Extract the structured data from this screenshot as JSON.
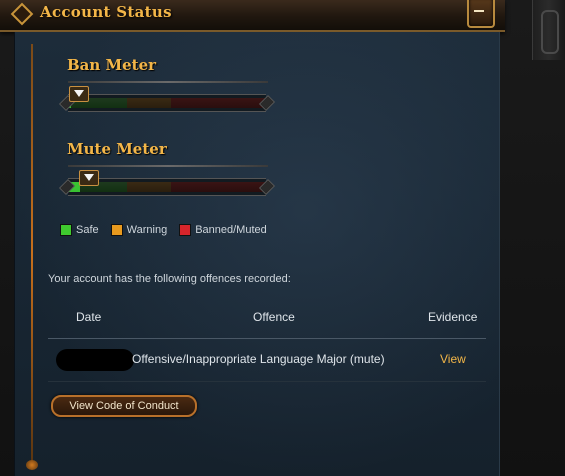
{
  "header": {
    "title": "Account Status"
  },
  "meters": [
    {
      "title": "Ban Meter",
      "level": 0.0
    },
    {
      "title": "Mute Meter",
      "level": 0.05
    }
  ],
  "legend": [
    {
      "label": "Safe",
      "color": "#3fca2f"
    },
    {
      "label": "Warning",
      "color": "#e89a1e"
    },
    {
      "label": "Banned/Muted",
      "color": "#d7252b"
    }
  ],
  "offences": {
    "intro": "Your account has the following offences recorded:",
    "columns": {
      "date": "Date",
      "offence": "Offence",
      "evidence": "Evidence"
    },
    "rows": [
      {
        "offence": "Offensive/Inappropriate Language Major (mute)",
        "evidence": "View"
      }
    ]
  },
  "actions": {
    "code_of_conduct": "View Code of Conduct"
  },
  "colors": {
    "accent": "#f3b648",
    "panel": "#1b2935"
  }
}
